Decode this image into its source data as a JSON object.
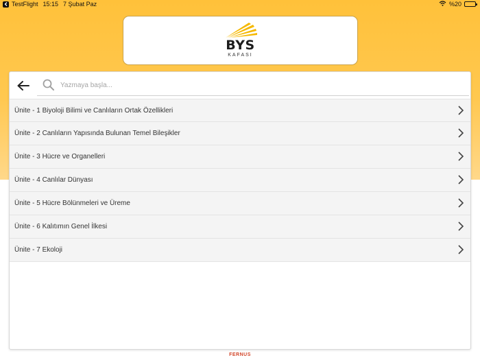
{
  "status_bar": {
    "app": "TestFlight",
    "time": "15:15",
    "date": "7 Şubat Paz",
    "battery": "%20"
  },
  "logo": {
    "main": "BYS",
    "sub": "KAFASI"
  },
  "search": {
    "placeholder": "Yazmaya başla..."
  },
  "list": {
    "items": [
      {
        "label": "Ünite - 1 Biyoloji Bilimi ve Canlıların Ortak Özellikleri"
      },
      {
        "label": "Ünite - 2 Canlıların Yapısında Bulunan Temel Bileşikler"
      },
      {
        "label": "Ünite - 3 Hücre ve Organelleri"
      },
      {
        "label": "Ünite - 4 Canlılar Dünyası"
      },
      {
        "label": "Ünite - 5 Hücre Bölünmeleri ve Üreme"
      },
      {
        "label": "Ünite - 6 Kalıtımın Genel İlkesi"
      },
      {
        "label": "Ünite - 7 Ekoloji"
      }
    ]
  },
  "footer": {
    "brand": "FERNUS"
  },
  "colors": {
    "accent": "#ffc13a",
    "brand_red": "#d2462a",
    "logo_gold": "#f5b800"
  },
  "icons": {
    "back": "arrow-left-icon",
    "search": "search-icon",
    "chevron": "chevron-right-icon",
    "wifi": "wifi-icon",
    "battery": "battery-icon"
  }
}
